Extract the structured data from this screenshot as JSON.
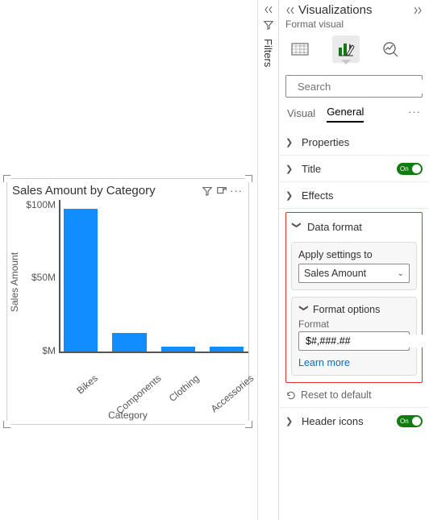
{
  "pane": {
    "title": "Visualizations",
    "subtitle": "Format visual",
    "search_placeholder": "Search",
    "tabs": {
      "visual": "Visual",
      "general": "General"
    },
    "sections": {
      "properties": "Properties",
      "title": "Title",
      "effects": "Effects",
      "data_format": "Data format",
      "header_icons": "Header icons"
    },
    "toggle_on": "On",
    "reset": "Reset to default",
    "data_format": {
      "apply_label": "Apply settings to",
      "apply_field": "Sales Amount",
      "options_title": "Format options",
      "format_label": "Format",
      "format_value": "$#,###.##",
      "learn_more": "Learn more"
    }
  },
  "filters": {
    "label": "Filters"
  },
  "chart": {
    "title": "Sales Amount by Category",
    "ylabel": "Sales Amount",
    "xlabel": "Category",
    "yticks": [
      "$100M",
      "$50M",
      "$M"
    ]
  },
  "chart_data": {
    "type": "bar",
    "title": "Sales Amount by Category",
    "xlabel": "Category",
    "ylabel": "Sales Amount",
    "ylim": [
      0,
      100
    ],
    "y_unit": "$M",
    "categories": [
      "Bikes",
      "Components",
      "Clothing",
      "Accessories"
    ],
    "values": [
      94,
      12,
      3,
      3
    ]
  }
}
